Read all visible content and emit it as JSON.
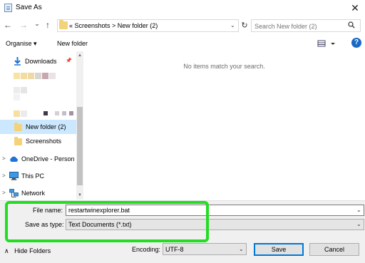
{
  "window": {
    "title": "Save As",
    "close_glyph": "✕"
  },
  "nav": {
    "back_glyph": "←",
    "forward_glyph": "→",
    "dropdown_glyph": "⌄",
    "up_glyph": "↑",
    "refresh_glyph": "↻",
    "address_path": "«  Screenshots  >  New folder (2)",
    "address_chevron": "⌄",
    "search_placeholder": "Search New folder (2)"
  },
  "toolbar": {
    "organise_label": "Organise ▾",
    "new_folder_label": "New folder",
    "help_label": "?"
  },
  "sidebar": {
    "items": [
      {
        "label": "Downloads",
        "pin": "📌"
      },
      {
        "label": "New folder (2)"
      },
      {
        "label": "Screenshots"
      },
      {
        "label": "OneDrive - Person"
      },
      {
        "label": "This PC"
      },
      {
        "label": "Network"
      }
    ],
    "expander_glyph": ">",
    "scroll_up": "▲",
    "scroll_down": "▼"
  },
  "content": {
    "empty_message": "No items match your search."
  },
  "form": {
    "file_name_label": "File name:",
    "file_name_value": "restartwinexplorer.bat",
    "save_as_type_label": "Save as type:",
    "save_as_type_value": "Text Documents (*.txt)",
    "chevron": "⌄"
  },
  "footer": {
    "hide_folders_label": "Hide Folders",
    "hide_glyph": "∧",
    "encoding_label": "Encoding:",
    "encoding_value": "UTF-8",
    "save_label": "Save",
    "cancel_label": "Cancel"
  },
  "colors": {
    "accent": "#0078d7",
    "highlight": "#22dd22",
    "selection": "#cce8ff",
    "folder": "#f3d27a"
  }
}
